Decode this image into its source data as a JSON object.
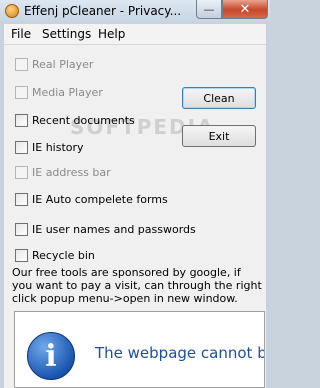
{
  "window": {
    "title": "Effenj pCleaner - Privacy..."
  },
  "menu": {
    "items": [
      "File",
      "Settings",
      "Help"
    ]
  },
  "options": [
    {
      "label": "Real Player",
      "enabled": false,
      "checked": false
    },
    {
      "label": "Media Player",
      "enabled": false,
      "checked": false
    },
    {
      "label": "Recent documents",
      "enabled": true,
      "checked": false
    },
    {
      "label": "IE history",
      "enabled": true,
      "checked": false
    },
    {
      "label": "IE address bar",
      "enabled": false,
      "checked": false
    },
    {
      "label": "IE Auto compelete forms",
      "enabled": true,
      "checked": false
    },
    {
      "label": "IE user names and passwords",
      "enabled": true,
      "checked": false
    },
    {
      "label": "Recycle bin",
      "enabled": true,
      "checked": false
    }
  ],
  "buttons": {
    "clean": "Clean",
    "exit": "Exit"
  },
  "sponsor_text": "Our free tools are sponsored by google, if you want to pay a visit, can through the right click popup menu->open in new window.",
  "browser": {
    "error_text": "The webpage cannot be",
    "icon": "info-icon"
  },
  "watermark": "SOFTPEDIA",
  "colors": {
    "close_button": "#c6462b",
    "error_text": "#1f4e9a",
    "info_icon": "#1b56b2"
  }
}
